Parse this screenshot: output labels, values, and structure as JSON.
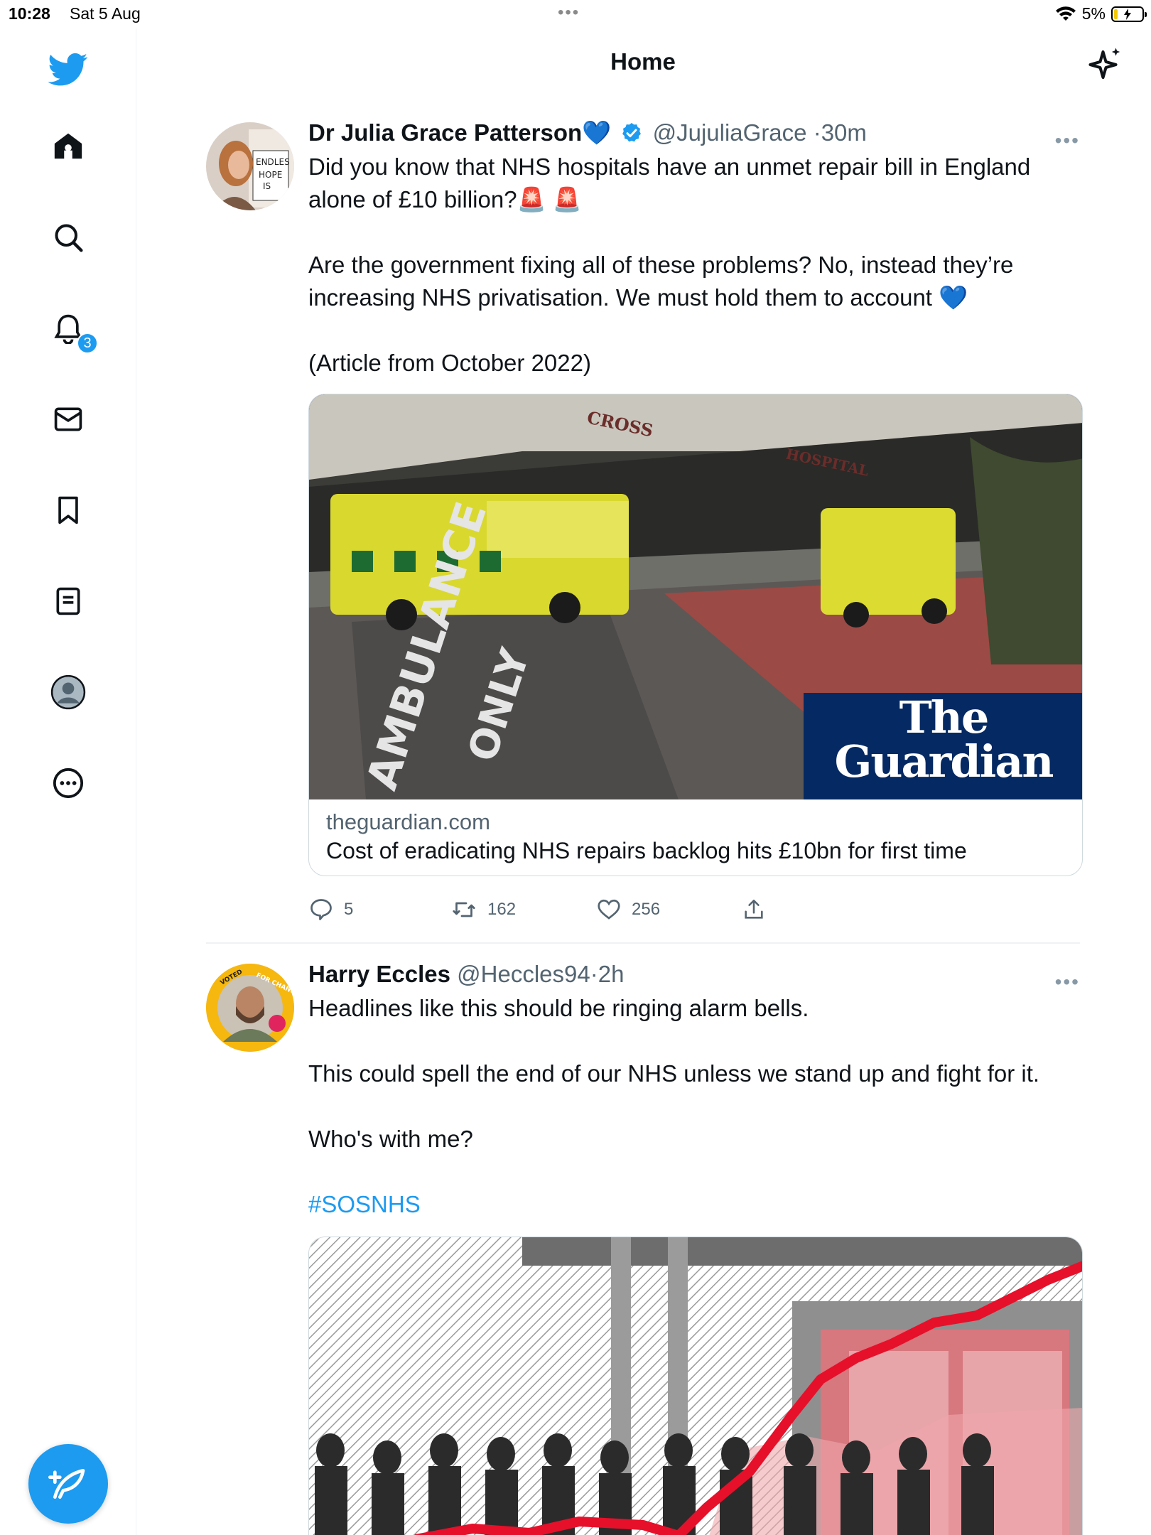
{
  "status_bar": {
    "time": "10:28",
    "date": "Sat 5 Aug",
    "battery": "5%"
  },
  "header": {
    "title": "Home"
  },
  "sidebar": {
    "items": [
      {
        "name": "home",
        "icon": "home-icon"
      },
      {
        "name": "explore",
        "icon": "search-icon"
      },
      {
        "name": "notifications",
        "icon": "bell-icon",
        "badge": "3"
      },
      {
        "name": "messages",
        "icon": "mail-icon"
      },
      {
        "name": "bookmarks",
        "icon": "bookmark-icon"
      },
      {
        "name": "lists",
        "icon": "list-icon"
      },
      {
        "name": "profile",
        "icon": "profile-icon"
      },
      {
        "name": "more",
        "icon": "more-circle-icon"
      }
    ]
  },
  "tweets": [
    {
      "author": "Dr Julia Grace Patterson💙",
      "handle": "@JujuliaGrace",
      "time": "30m",
      "text": [
        "Did you know that NHS hospitals have an unmet repair bill in England alone of £10 billion?🚨 🚨",
        "Are the government fixing all of these problems? No, instead they’re increasing NHS privatisation. We must hold them to account 💙",
        "(Article from October 2022)"
      ],
      "card": {
        "image_brand": "The Guardian",
        "domain": "theguardian.com",
        "title": "Cost of eradicating NHS repairs backlog hits £10bn for first time"
      },
      "stats": {
        "replies": "5",
        "retweets": "162",
        "likes": "256"
      }
    },
    {
      "author": "Harry Eccles",
      "handle": "@Heccles94",
      "time": "2h",
      "text": [
        "Headlines like this should be ringing alarm bells.",
        "This could spell the end of our NHS unless we stand up and fight for it.",
        "Who's with me?"
      ],
      "hashtag": "#SOSNHS"
    }
  ],
  "colors": {
    "accent": "#1d9bf0",
    "text": "#0f1419",
    "muted": "#536471",
    "guardian_blue": "#052962"
  }
}
